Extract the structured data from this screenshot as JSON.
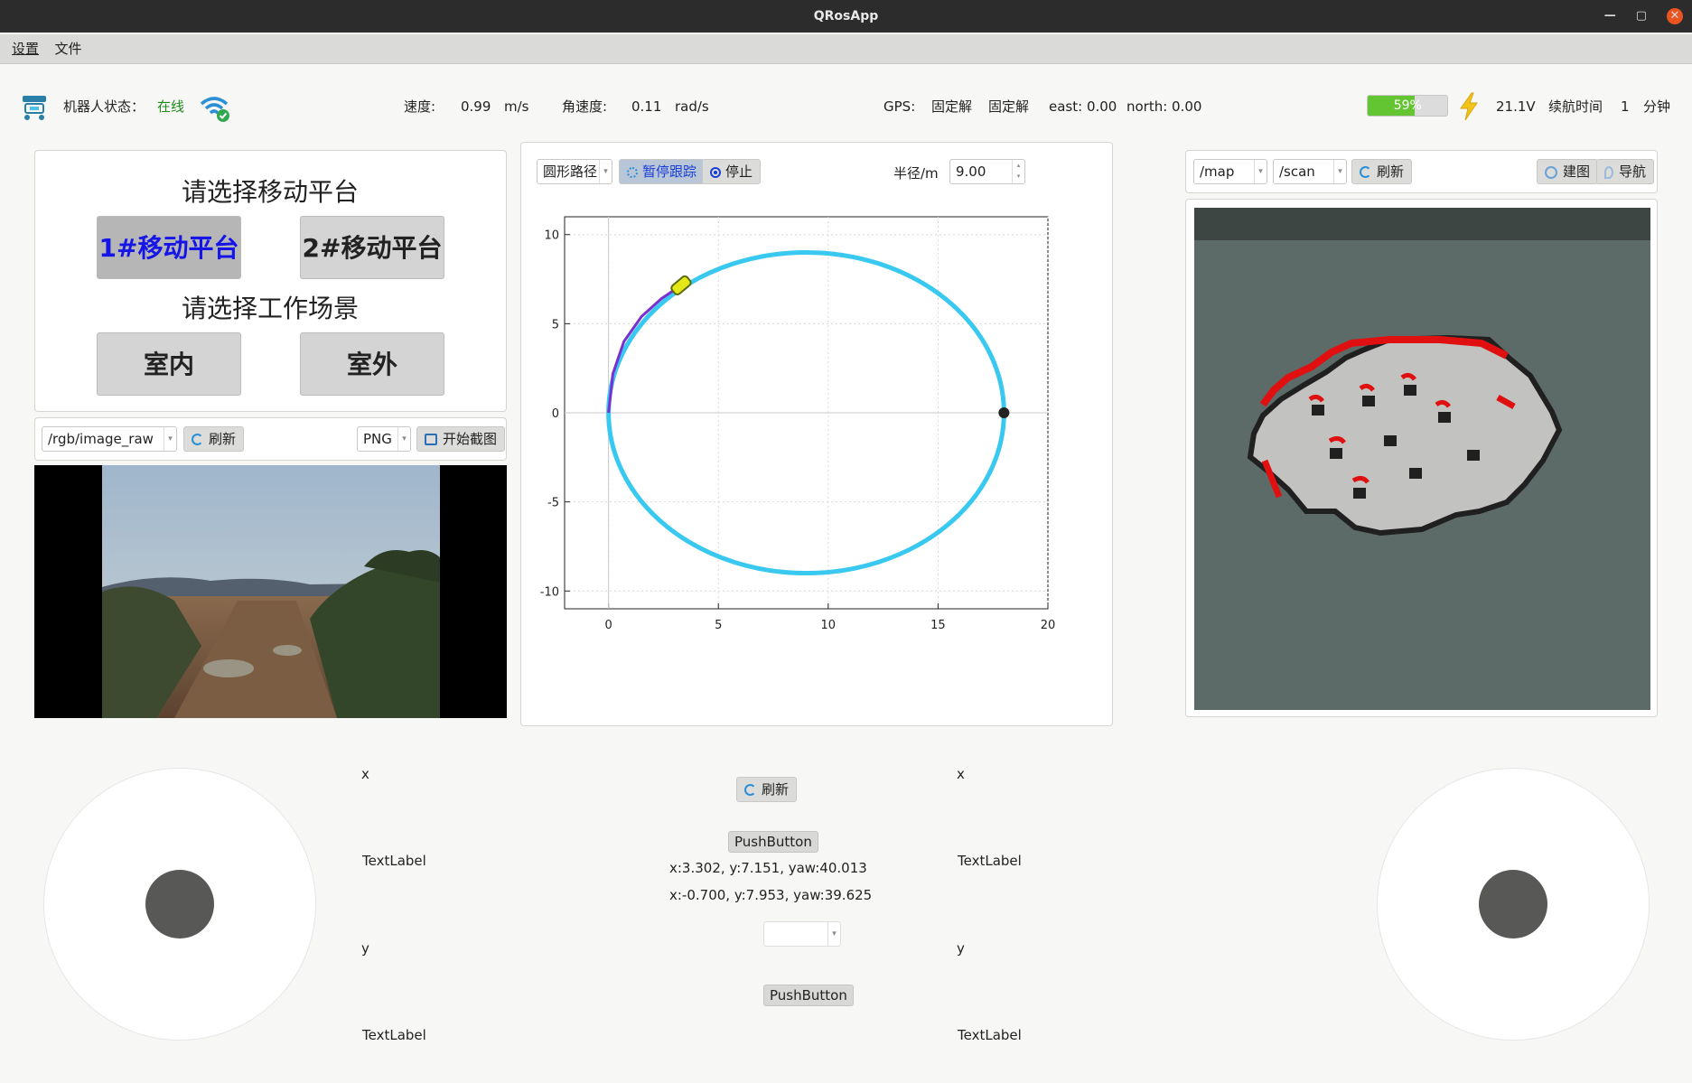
{
  "window": {
    "title": "QRosApp"
  },
  "menu": {
    "settings": "设置",
    "file": "文件"
  },
  "status": {
    "robot_label": "机器人状态：",
    "robot_value": "在线",
    "speed_label": "速度:",
    "speed_value": "0.99",
    "speed_unit": "m/s",
    "angular_label": "角速度:",
    "angular_value": "0.11",
    "angular_unit": "rad/s",
    "gps_label": "GPS:",
    "gps_fix1": "固定解",
    "gps_fix2": "固定解",
    "east": "east: 0.00",
    "north": "north: 0.00",
    "battery_text": "59%",
    "battery_level": 0.59,
    "voltage": "21.1V",
    "endurance_label": "续航时间",
    "endurance_value": "1",
    "endurance_unit": "分钟",
    "online_color": "#1e8a1e",
    "battery_color": "#63c531"
  },
  "platform": {
    "title": "请选择移动平台",
    "btn1": "1#移动平台",
    "btn2": "2#移动平台",
    "scene_title": "请选择工作场景",
    "indoor": "室内",
    "outdoor": "室外",
    "active_color": "#1515e8"
  },
  "camera": {
    "topic": "/rgb/image_raw",
    "refresh": "刷新",
    "format": "PNG",
    "capture": "开始截图"
  },
  "path": {
    "mode": "圆形路径",
    "pause": "暂停跟踪",
    "stop": "停止",
    "radius_label": "半径/m",
    "radius_value": "9.00"
  },
  "chart_data": {
    "type": "line",
    "title": "",
    "xlabel": "",
    "ylabel": "",
    "xlim": [
      -2,
      20
    ],
    "ylim": [
      -11,
      11
    ],
    "xticks": [
      0,
      5,
      10,
      15,
      20
    ],
    "yticks": [
      -10,
      -5,
      0,
      5,
      10
    ],
    "grid": true,
    "series": [
      {
        "shape": "ellipse",
        "center": [
          9,
          0
        ],
        "radii": [
          9,
          9
        ],
        "color": "#38c8f0"
      },
      {
        "shape": "trace",
        "x": [
          0,
          0.2,
          0.7,
          1.5,
          2.4,
          3.3
        ],
        "y": [
          0,
          2.2,
          4.0,
          5.4,
          6.4,
          7.15
        ],
        "color": "#7a2fd0"
      }
    ],
    "vehicle": {
      "x": 3.302,
      "y": 7.151,
      "yaw": 40.013
    },
    "goal_point": {
      "x": 18,
      "y": 0
    }
  },
  "map": {
    "map_topic": "/map",
    "scan_topic": "/scan",
    "refresh": "刷新",
    "build": "建图",
    "navigate": "导航"
  },
  "bottom": {
    "x_label_left": "x",
    "text_label_1": "TextLabel",
    "y_label_left": "y",
    "text_label_2": "TextLabel",
    "x_label_right": "x",
    "text_label_3": "TextLabel",
    "y_label_right": "y",
    "text_label_4": "TextLabel",
    "refresh": "刷新",
    "push1": "PushButton",
    "pose1": "x:3.302, y:7.151, yaw:40.013",
    "pose2": "x:-0.700, y:7.953, yaw:39.625",
    "push2": "PushButton"
  }
}
